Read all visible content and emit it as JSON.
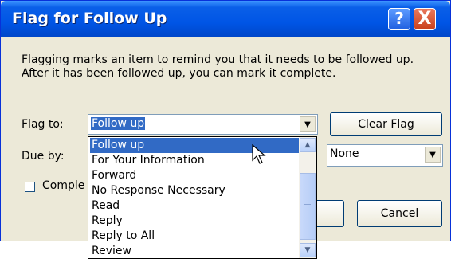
{
  "window": {
    "title": "Flag for Follow Up",
    "help_glyph": "?",
    "close_glyph": "X"
  },
  "description": {
    "line1": "Flagging marks an item to remind you that it needs to be followed up.",
    "line2": "After it has been followed up, you can mark it complete."
  },
  "flag_to": {
    "label": "Flag to:",
    "value": "Follow up"
  },
  "clear_flag_label": "Clear Flag",
  "due_by": {
    "label": "Due by:",
    "time_value": "None"
  },
  "completed_checkbox": {
    "label_visible": "Comple",
    "checked": false
  },
  "cancel_label": "Cancel",
  "dropdown": {
    "highlighted_index": 0,
    "options": [
      "Follow up",
      "For Your Information",
      "Forward",
      "No Response Necessary",
      "Read",
      "Reply",
      "Reply to All",
      "Review"
    ]
  },
  "colors": {
    "titlebar": "#0055e5",
    "dialog_bg": "#ece9d8",
    "selection": "#316ac5"
  }
}
